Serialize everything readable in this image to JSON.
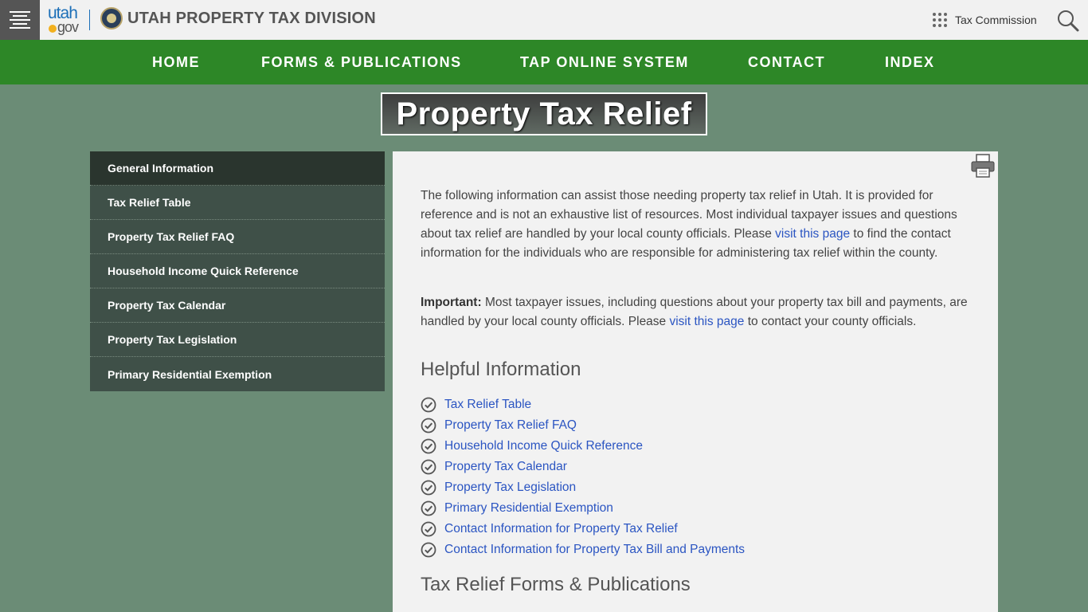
{
  "header": {
    "logo_top": "utah",
    "logo_bottom": "gov",
    "site_title": "UTAH PROPERTY TAX DIVISION",
    "tax_commission": "Tax Commission"
  },
  "nav": {
    "home": "HOME",
    "forms": "FORMS & PUBLICATIONS",
    "tap": "TAP ONLINE SYSTEM",
    "contact": "CONTACT",
    "index": "INDEX"
  },
  "page_title": "Property Tax Relief",
  "sidebar": {
    "items": [
      {
        "label": "General Information"
      },
      {
        "label": "Tax Relief Table"
      },
      {
        "label": "Property Tax Relief FAQ"
      },
      {
        "label": "Household Income Quick Reference"
      },
      {
        "label": "Property Tax Calendar"
      },
      {
        "label": "Property Tax Legislation"
      },
      {
        "label": "Primary Residential Exemption"
      }
    ]
  },
  "content": {
    "intro_a": "The following information can assist those needing property tax relief in Utah. It is provided for reference and is not an exhaustive list of resources. Most individual taxpayer issues and questions about tax relief are handled by your local county officials. Please ",
    "intro_link": "visit this page",
    "intro_b": " to find the contact information for the individuals who are responsible for administering tax relief within the county.",
    "important_label": "Important:",
    "important_a": " Most taxpayer issues, including questions about your property tax bill and payments, are handled by your local county officials. Please ",
    "important_link": "visit this page",
    "important_b": " to contact your county officials.",
    "helpful_heading": "Helpful Information",
    "helpful_links": [
      {
        "label": "Tax Relief Table"
      },
      {
        "label": "Property Tax Relief FAQ"
      },
      {
        "label": "Household Income Quick Reference"
      },
      {
        "label": "Property Tax Calendar"
      },
      {
        "label": "Property Tax Legislation"
      },
      {
        "label": "Primary Residential Exemption"
      },
      {
        "label": "Contact Information for Property Tax Relief"
      },
      {
        "label": "Contact Information for Property Tax Bill and Payments"
      }
    ],
    "forms_heading": "Tax Relief Forms & Publications"
  },
  "colors": {
    "background": "#6b8c76",
    "nav_green": "#2d8727",
    "sidebar": "#3f5048",
    "sidebar_active": "#2a352e",
    "link": "#2b55c2"
  },
  "icons": [
    "menu-icon",
    "grid-icon",
    "search-icon",
    "print-icon",
    "check-circle-icon"
  ]
}
